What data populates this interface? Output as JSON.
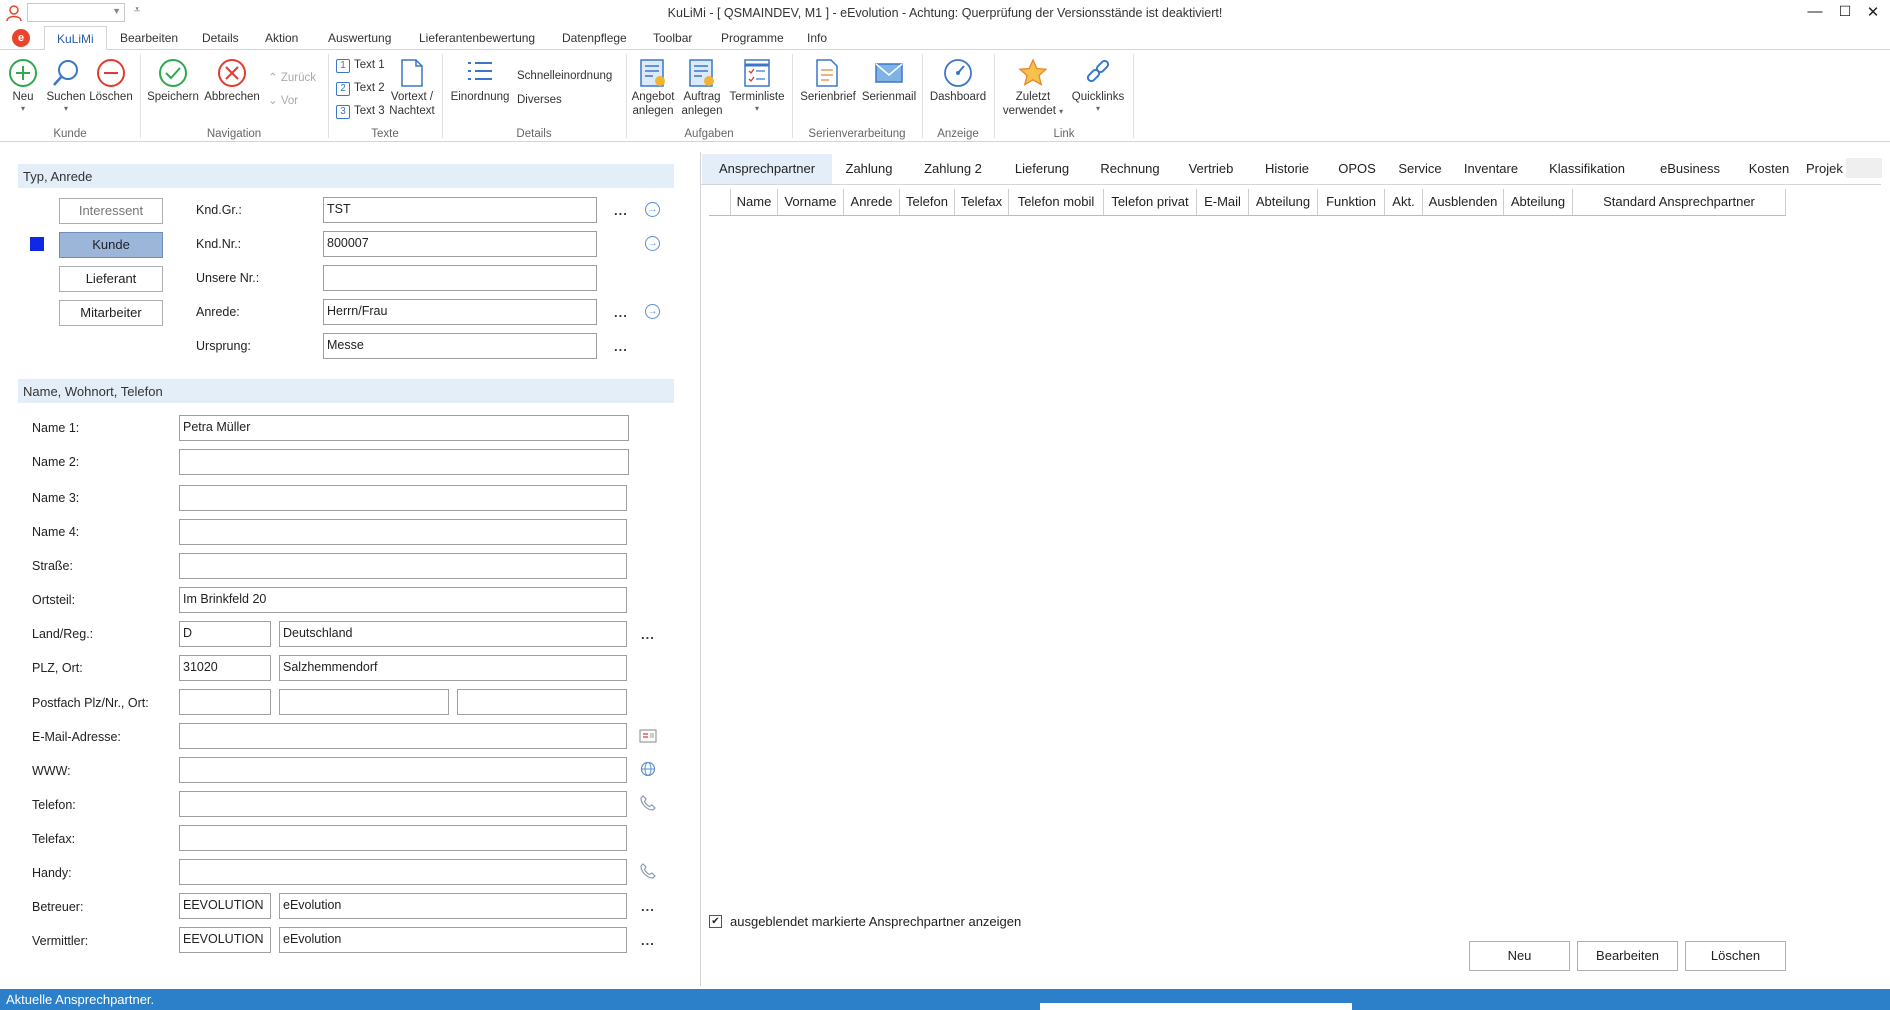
{
  "window": {
    "title": "KuLiMi - [ QSMAINDEV, M1 ]  -  eEvolution - Achtung: Querprüfung der Versionsstände ist deaktiviert!"
  },
  "menu": {
    "tabs": [
      "KuLiMi",
      "Bearbeiten",
      "Details",
      "Aktion",
      "Auswertung",
      "Lieferantenbewertung",
      "Datenpflege",
      "Toolbar",
      "Programme",
      "Info"
    ]
  },
  "ribbon": {
    "kunde": {
      "label": "Kunde",
      "neu": "Neu",
      "suchen": "Suchen",
      "loeschen": "Löschen"
    },
    "navigation": {
      "label": "Navigation",
      "speichern": "Speichern",
      "abbrechen": "Abbrechen",
      "zurueck": "Zurück",
      "vor": "Vor"
    },
    "texte": {
      "label": "Texte",
      "text1": "Text 1",
      "text2": "Text 2",
      "text3": "Text 3",
      "vortext_l1": "Vortext /",
      "vortext_l2": "Nachtext"
    },
    "details": {
      "label": "Details",
      "einordnung": "Einordnung",
      "schnell": "Schnelleinordnung",
      "diverses": "Diverses"
    },
    "aufgaben": {
      "label": "Aufgaben",
      "angebot_l1": "Angebot",
      "angebot_l2": "anlegen",
      "auftrag_l1": "Auftrag",
      "auftrag_l2": "anlegen",
      "terminliste": "Terminliste"
    },
    "serien": {
      "label": "Serienverarbeitung",
      "brief": "Serienbrief",
      "mail": "Serienmail"
    },
    "anzeige": {
      "label": "Anzeige",
      "dashboard": "Dashboard"
    },
    "link": {
      "label": "Link",
      "zuletzt_l1": "Zuletzt",
      "zuletzt_l2": "verwendet",
      "quicklinks": "Quicklinks"
    }
  },
  "typ_section": {
    "title": "Typ, Anrede",
    "types": [
      "Interessent",
      "Kunde",
      "Lieferant",
      "Mitarbeiter"
    ],
    "fields": [
      {
        "label": "Knd.Gr.:",
        "value": "TST"
      },
      {
        "label": "Knd.Nr.:",
        "value": "800007"
      },
      {
        "label": "Unsere Nr.:",
        "value": ""
      },
      {
        "label": "Anrede:",
        "value": "Herrn/Frau"
      },
      {
        "label": "Ursprung:",
        "value": "Messe"
      }
    ]
  },
  "name_section": {
    "title": "Name, Wohnort, Telefon",
    "labels": {
      "name1": "Name 1:",
      "name2": "Name 2:",
      "name3": "Name 3:",
      "name4": "Name 4:",
      "strasse": "Straße:",
      "ortsteil": "Ortsteil:",
      "land": "Land/Reg.:",
      "plz": "PLZ, Ort:",
      "postfach": "Postfach Plz/Nr., Ort:",
      "email": "E-Mail-Adresse:",
      "www": "WWW:",
      "telefon": "Telefon:",
      "telefax": "Telefax:",
      "handy": "Handy:",
      "betreuer": "Betreuer:",
      "vermittler": "Vermittler:"
    },
    "values": {
      "name1": "Petra Müller",
      "name2": "",
      "name3": "",
      "name4": "",
      "strasse": "",
      "ortsteil": "Im Brinkfeld 20",
      "land_code": "D",
      "land_name": "Deutschland",
      "plz": "31020",
      "ort": "Salzhemmendorf",
      "postfach_plz": "",
      "postfach_nr": "",
      "postfach_ort": "",
      "email": "",
      "www": "",
      "telefon": "",
      "telefax": "",
      "handy": "",
      "betreuer_code": "EEVOLUTION",
      "betreuer_name": "eEvolution",
      "vermittler_code": "EEVOLUTION",
      "vermittler_name": "eEvolution"
    }
  },
  "right_tabs": [
    "Ansprechpartner",
    "Zahlung",
    "Zahlung 2",
    "Lieferung",
    "Rechnung",
    "Vertrieb",
    "Historie",
    "OPOS",
    "Service",
    "Inventare",
    "Klassifikation",
    "eBusiness",
    "Kosten",
    "Projek"
  ],
  "grid": {
    "columns": [
      "",
      "Name",
      "Vorname",
      "Anrede",
      "Telefon",
      "Telefax",
      "Telefon mobil",
      "Telefon privat",
      "E-Mail",
      "Abteilung",
      "Funktion",
      "Akt.",
      "Ausblenden",
      "Abteilung",
      "Standard Ansprechpartner"
    ]
  },
  "footer": {
    "checkbox_label": "ausgeblendet markierte Ansprechpartner anzeigen",
    "checkbox_mark": "✔",
    "buttons": {
      "neu": "Neu",
      "bearbeiten": "Bearbeiten",
      "loeschen": "Löschen"
    }
  },
  "status": {
    "text": "Aktuelle Ansprechpartner."
  },
  "colors": {
    "accent": "#2c7fc9",
    "section_bg": "#e3eef9",
    "selected_type": "#9bb6d9",
    "type_marker": "#0f28e6"
  }
}
